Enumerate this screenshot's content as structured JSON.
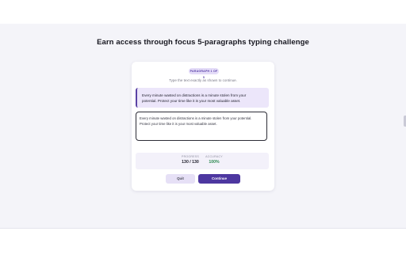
{
  "page": {
    "title": "Earn access through focus 5-paragraphs typing challenge"
  },
  "card": {
    "badge": "PARAGRAPH 1 OF 5",
    "instruction": "Type the text exactly as shown to continue.",
    "quote": "Every minute wasted on distractions is a minute stolen from your potential. Protect your time like it is your most valuable asset.",
    "typed_value": "Every minute wasted on distractions is a minute stolen from your potential. Protect your time like it is your most valuable asset.",
    "stats": {
      "progress_label": "PROGRESS",
      "progress_value": "130 / 130",
      "accuracy_label": "ACCURACY",
      "accuracy_value": "100%"
    },
    "buttons": {
      "quit": "Quit",
      "continue": "Continue"
    }
  },
  "colors": {
    "accent": "#4d37a0",
    "quote_background": "#ece6fa",
    "accuracy_good": "#2e8a52",
    "page_background": "#f4f4f9"
  }
}
